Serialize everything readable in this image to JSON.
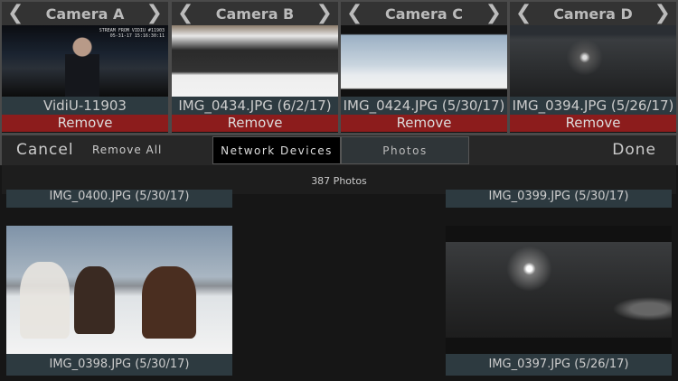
{
  "cameras": [
    {
      "title": "Camera A",
      "source": "VidiU-11903",
      "remove": "Remove",
      "overlay": "STREAM FROM VIDIU #11903\n05-31-17 15:16:30:11"
    },
    {
      "title": "Camera B",
      "source": "IMG_0434.JPG (6/2/17)",
      "remove": "Remove"
    },
    {
      "title": "Camera C",
      "source": "IMG_0424.JPG (5/30/17)",
      "remove": "Remove"
    },
    {
      "title": "Camera D",
      "source": "IMG_0394.JPG (5/26/17)",
      "remove": "Remove"
    }
  ],
  "toolbar": {
    "cancel": "Cancel",
    "remove_all": "Remove All",
    "tabs": [
      "Network Devices",
      "Photos"
    ],
    "done": "Done"
  },
  "photo_count": "387 Photos",
  "photos": [
    "IMG_0400.JPG (5/30/17)",
    "IMG_0399.JPG (5/30/17)",
    "IMG_0398.JPG (5/30/17)",
    "IMG_0397.JPG (5/26/17)"
  ]
}
